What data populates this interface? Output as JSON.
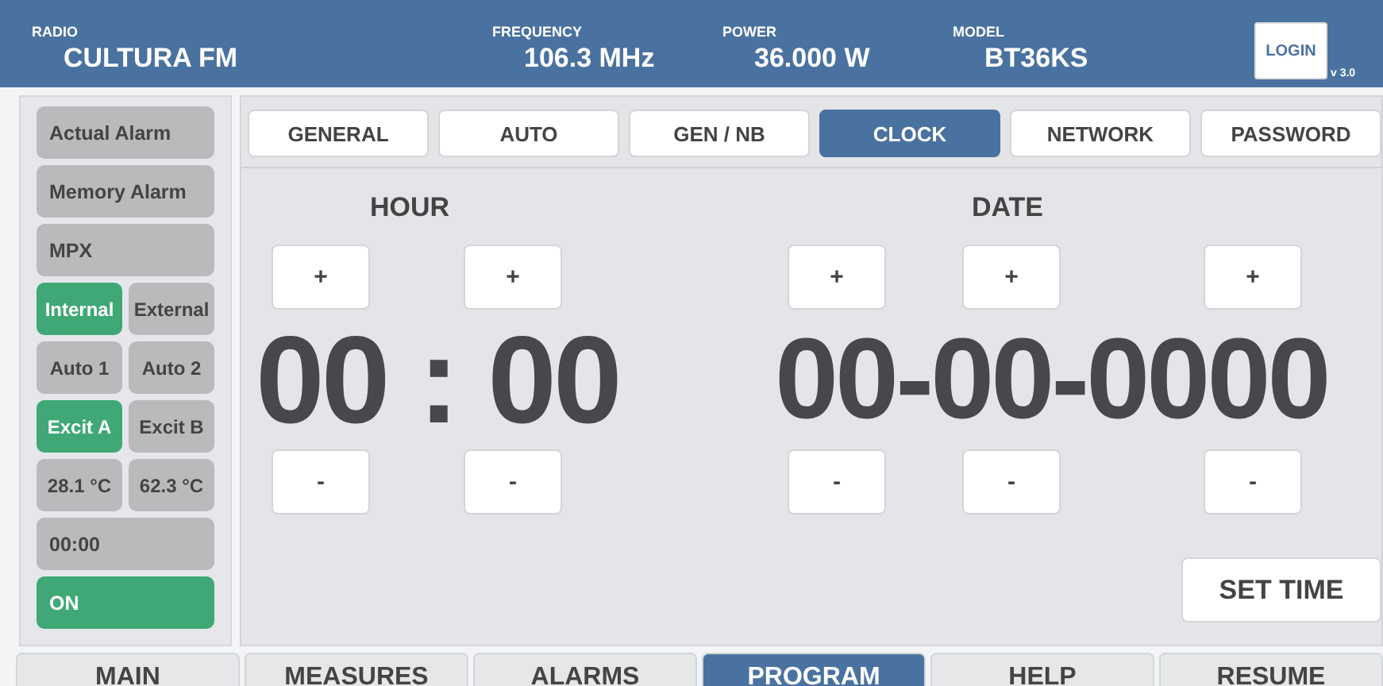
{
  "header": {
    "fields": [
      {
        "label": "RADIO",
        "value": "CULTURA FM"
      },
      {
        "label": "FREQUENCY",
        "value": "106.3 MHz"
      },
      {
        "label": "POWER",
        "value": "36.000 W"
      },
      {
        "label": "MODEL",
        "value": "BT36KS"
      }
    ],
    "login": "LOGIN",
    "version": "v 3.0"
  },
  "sidebar": [
    {
      "cells": [
        {
          "label": "Actual Alarm",
          "on": false
        }
      ]
    },
    {
      "cells": [
        {
          "label": "Memory Alarm",
          "on": false
        }
      ]
    },
    {
      "cells": [
        {
          "label": "MPX",
          "on": false
        }
      ]
    },
    {
      "cells": [
        {
          "label": "Internal",
          "on": true
        },
        {
          "label": "External",
          "on": false
        }
      ]
    },
    {
      "cells": [
        {
          "label": "Auto 1",
          "on": false
        },
        {
          "label": "Auto 2",
          "on": false
        }
      ]
    },
    {
      "cells": [
        {
          "label": "Excit A",
          "on": true
        },
        {
          "label": "Excit B",
          "on": false
        }
      ]
    },
    {
      "cells": [
        {
          "label": "28.1 °C",
          "on": false
        },
        {
          "label": "62.3 °C",
          "on": false
        }
      ]
    },
    {
      "cells": [
        {
          "label": "00:00",
          "on": false
        }
      ]
    },
    {
      "cells": [
        {
          "label": "ON",
          "on": true
        }
      ]
    }
  ],
  "tabs": [
    {
      "label": "GENERAL",
      "selected": false
    },
    {
      "label": "AUTO",
      "selected": false
    },
    {
      "label": "GEN / NB",
      "selected": false
    },
    {
      "label": "CLOCK",
      "selected": true
    },
    {
      "label": "NETWORK",
      "selected": false
    },
    {
      "label": "PASSWORD",
      "selected": false
    }
  ],
  "clock": {
    "hour": {
      "title": "HOUR",
      "display": "00 : 00",
      "plus": [
        "+",
        "+"
      ],
      "minus": [
        "-",
        "-"
      ]
    },
    "date": {
      "title": "DATE",
      "display": "00-00-0000",
      "plus": [
        "+",
        "+",
        "+"
      ],
      "minus": [
        "-",
        "-",
        "-"
      ]
    },
    "set_button": "SET TIME"
  },
  "nav": [
    {
      "label": "MAIN",
      "selected": false
    },
    {
      "label": "MEASURES",
      "selected": false
    },
    {
      "label": "ALARMS",
      "selected": false
    },
    {
      "label": "PROGRAM",
      "selected": true
    },
    {
      "label": "HELP",
      "selected": false
    },
    {
      "label": "RESUME",
      "selected": false
    }
  ]
}
